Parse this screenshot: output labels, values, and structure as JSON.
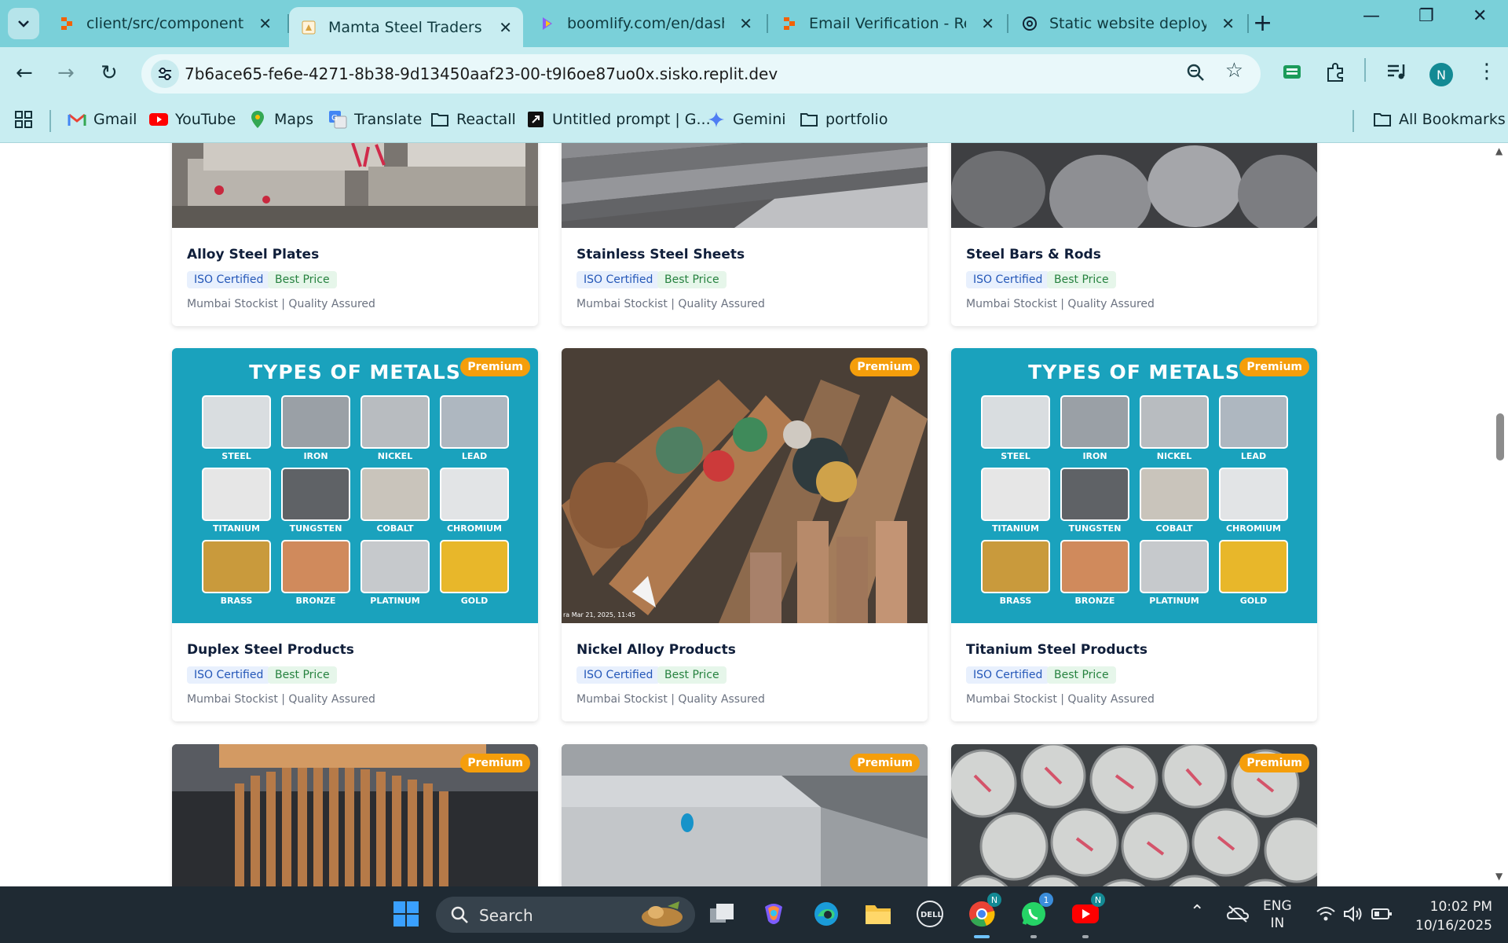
{
  "browser": {
    "tabs": [
      {
        "title": "client/src/components/Pr",
        "icon": "replit-icon",
        "active": false
      },
      {
        "title": "Mamta Steel Traders - Le",
        "icon": "site-icon",
        "active": true
      },
      {
        "title": "boomlify.com/en/dashbo",
        "icon": "boomlify-icon",
        "active": false
      },
      {
        "title": "Email Verification - Replit",
        "icon": "replit-icon",
        "active": false
      },
      {
        "title": "Static website deploy kar",
        "icon": "chatgpt-icon",
        "active": false
      }
    ],
    "url": "7b6ace65-fe6e-4271-8b38-9d13450aaf23-00-t9l6oe87uo0x.sisko.replit.dev",
    "profile_initial": "N",
    "bookmarks": [
      {
        "label": "Gmail",
        "icon": "gmail-icon"
      },
      {
        "label": "YouTube",
        "icon": "youtube-icon"
      },
      {
        "label": "Maps",
        "icon": "maps-icon"
      },
      {
        "label": "Translate",
        "icon": "translate-icon"
      },
      {
        "label": "Reactall",
        "icon": "folder-icon"
      },
      {
        "label": "Untitled prompt | G...",
        "icon": "ai-studio-icon"
      },
      {
        "label": "Gemini",
        "icon": "gemini-icon"
      },
      {
        "label": "portfolio",
        "icon": "folder-icon"
      }
    ],
    "all_bookmarks": "All Bookmarks"
  },
  "products": {
    "badge_iso": "ISO Certified",
    "badge_price": "Best Price",
    "meta": "Mumbai Stockist | Quality Assured",
    "premium_label": "Premium",
    "row1": [
      {
        "title": "Alloy Steel Plates"
      },
      {
        "title": "Stainless Steel Sheets"
      },
      {
        "title": "Steel Bars & Rods"
      }
    ],
    "row2": [
      {
        "title": "Duplex Steel Products"
      },
      {
        "title": "Nickel Alloy Products"
      },
      {
        "title": "Titanium Steel Products"
      }
    ],
    "metals_poster": {
      "heading": "TYPES OF METALS",
      "metals": [
        "STEEL",
        "IRON",
        "NICKEL",
        "LEAD",
        "TITANIUM",
        "TUNGSTEN",
        "COBALT",
        "CHROMIUM",
        "BRASS",
        "BRONZE",
        "PLATINUM",
        "GOLD"
      ]
    },
    "photo_stamp": "ra Mar 21, 2025, 11:45"
  },
  "taskbar": {
    "search_label": "Search",
    "lang_line1": "ENG",
    "lang_line2": "IN",
    "time": "10:02 PM",
    "date": "10/16/2025",
    "whatsapp_badge": "1",
    "chrome_badge": "N",
    "youtube_badge": "N"
  }
}
